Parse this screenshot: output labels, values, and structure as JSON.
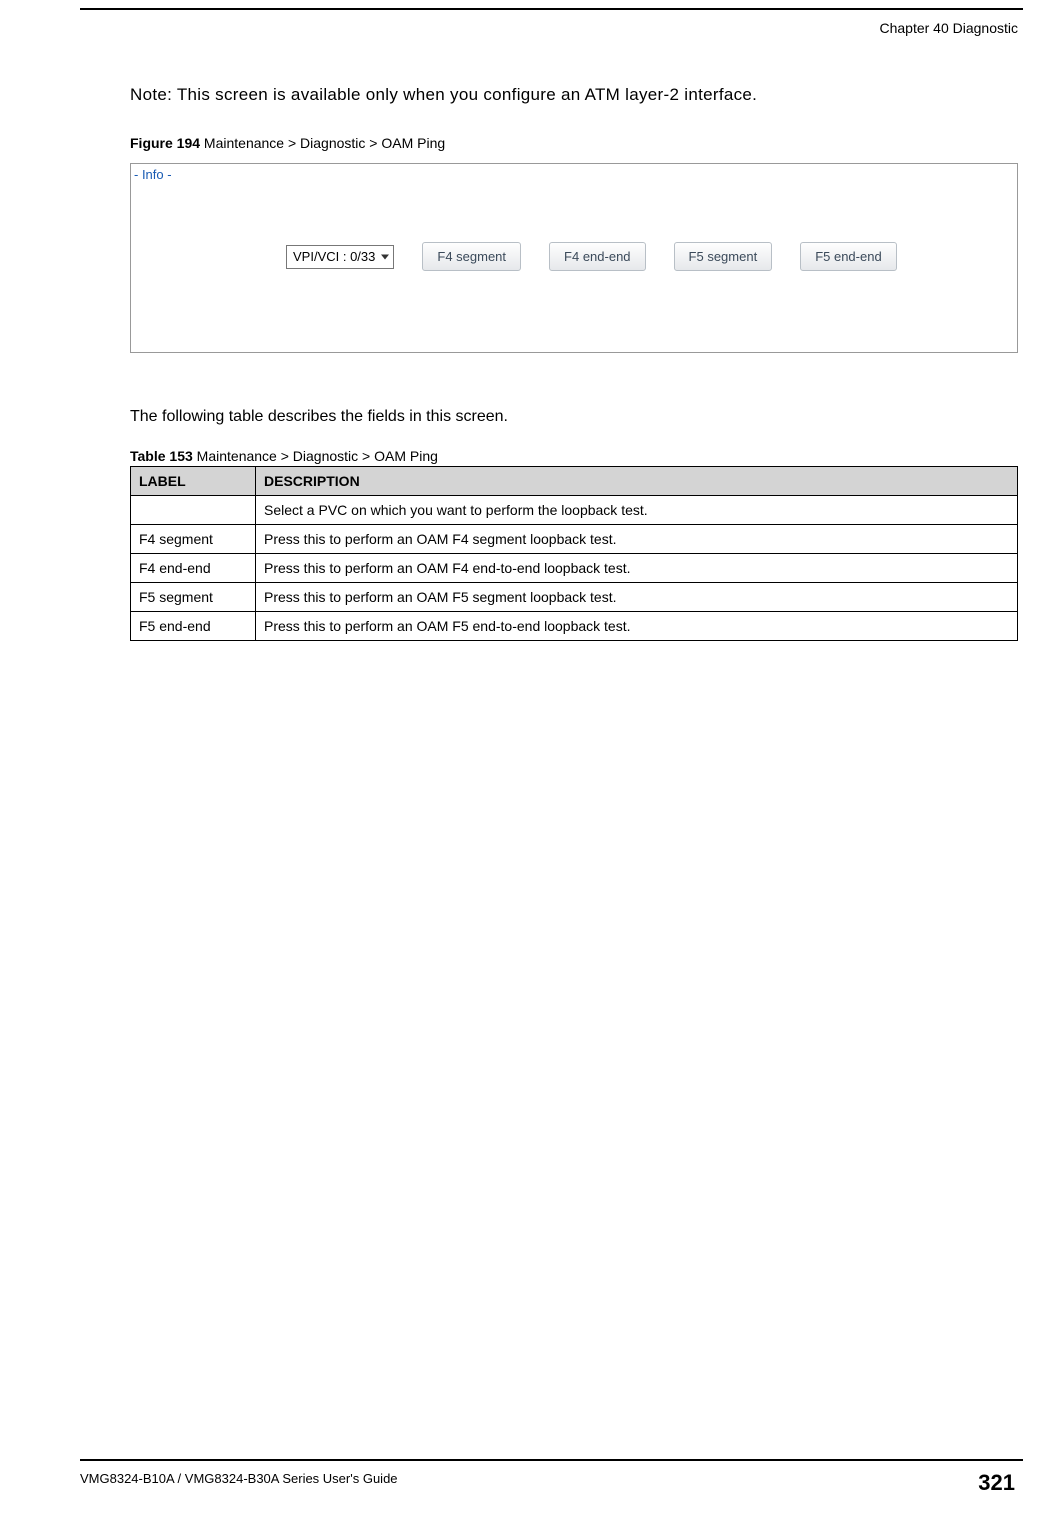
{
  "header": {
    "chapter": "Chapter 40 Diagnostic"
  },
  "note": "Note: This screen is available only when you configure an ATM layer-2 interface.",
  "figure": {
    "caption_bold": "Figure 194",
    "caption_text": "   Maintenance > Diagnostic > OAM Ping",
    "info_label": "- Info -",
    "vpi_select": "VPI/VCI : 0/33",
    "buttons": {
      "f4_segment": "F4 segment",
      "f4_end_end": "F4 end-end",
      "f5_segment": "F5 segment",
      "f5_end_end": "F5 end-end"
    }
  },
  "table_intro": "The following table describes the fields in this screen.",
  "table": {
    "caption_bold": "Table 153",
    "caption_text": "   Maintenance > Diagnostic > OAM Ping",
    "headers": {
      "label": "LABEL",
      "description": "DESCRIPTION"
    },
    "rows": [
      {
        "label": "",
        "description": "Select a PVC on which you want to perform the loopback test."
      },
      {
        "label": "F4 segment",
        "description": "Press this to perform an OAM F4 segment loopback test."
      },
      {
        "label": "F4 end-end",
        "description": "Press this to perform an OAM F4 end-to-end loopback test."
      },
      {
        "label": "F5 segment",
        "description": "Press this to perform an OAM F5 segment loopback test."
      },
      {
        "label": "F5 end-end",
        "description": "Press this to perform an OAM F5 end-to-end loopback test."
      }
    ]
  },
  "footer": {
    "guide": "VMG8324-B10A / VMG8324-B30A Series User's Guide",
    "page": "321"
  }
}
